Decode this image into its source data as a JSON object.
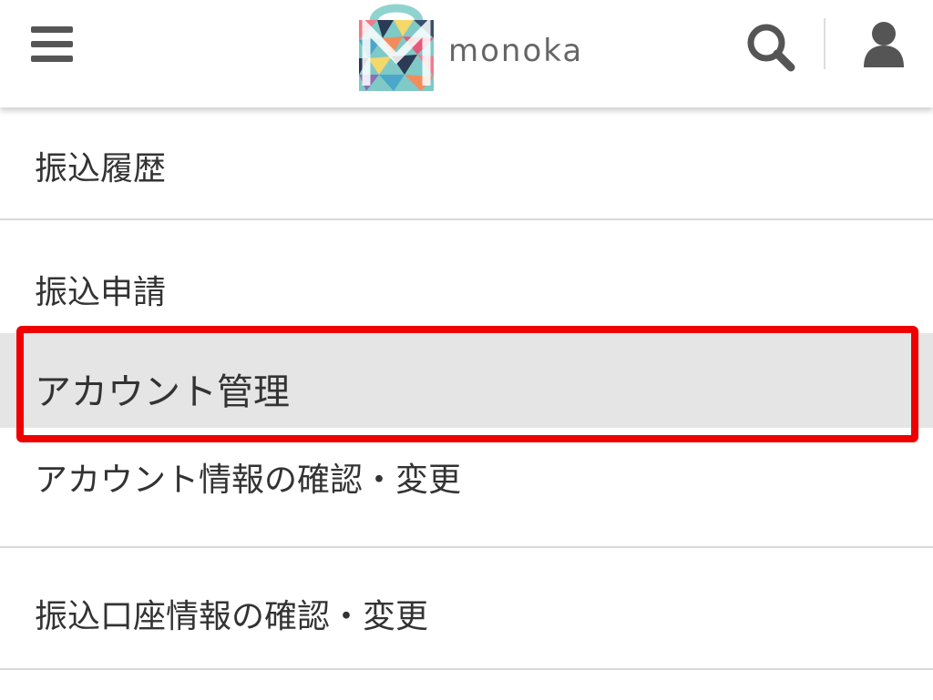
{
  "header": {
    "logo_text": "monoka",
    "icons": {
      "menu": "hamburger-menu-icon",
      "search": "search-icon",
      "user": "user-icon"
    }
  },
  "menu": {
    "items": [
      {
        "label": "振込履歴"
      },
      {
        "label": "振込申請"
      },
      {
        "label": "アカウント管理",
        "selected": true
      },
      {
        "label": "アカウント情報の確認・変更"
      },
      {
        "label": "振込口座情報の確認・変更"
      }
    ]
  },
  "colors": {
    "highlight_border": "#ee0000",
    "selected_background": "#e5e5e5",
    "icon_gray": "#555555",
    "logo_teal": "#8fd3cf"
  }
}
